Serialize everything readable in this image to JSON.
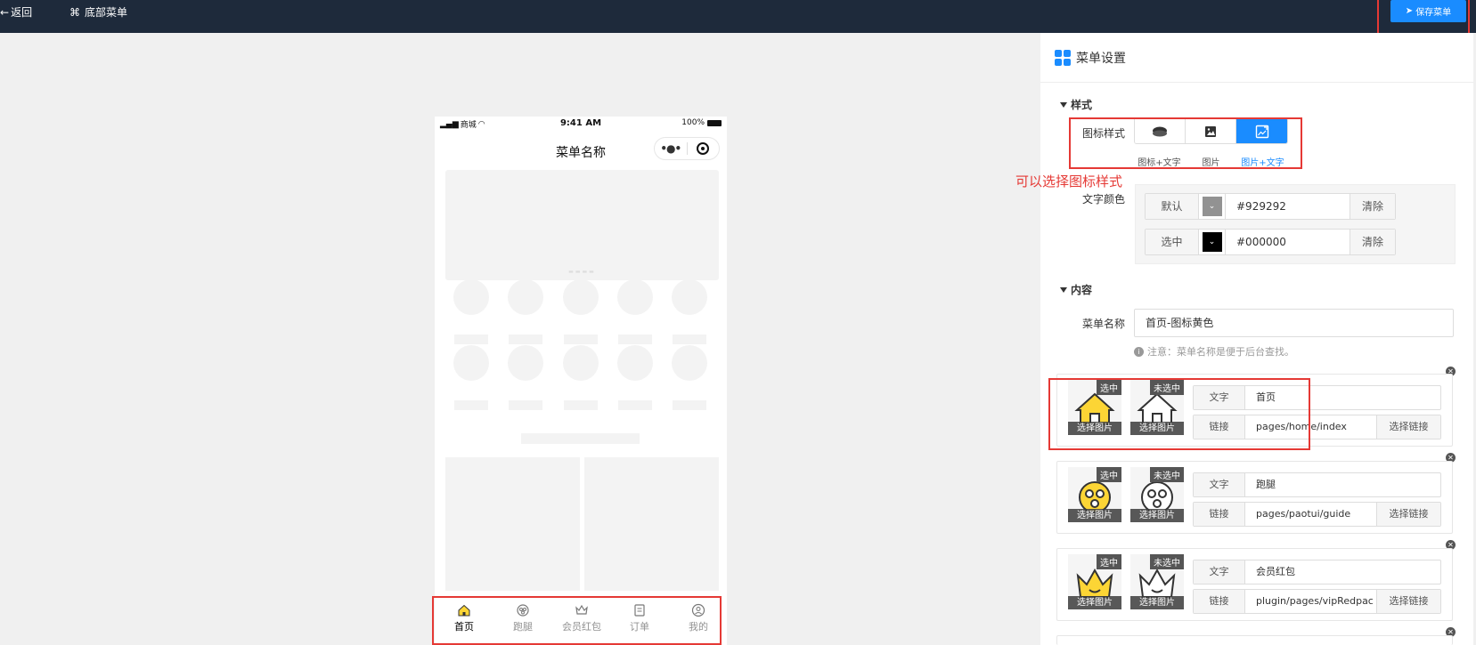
{
  "topbar": {
    "back_label": "返回",
    "title": "底部菜单",
    "save_label": "保存菜单"
  },
  "phone": {
    "carrier": "商城",
    "time": "9:41 AM",
    "battery": "100%",
    "nav_title": "菜单名称",
    "tabs": [
      {
        "label": "首页",
        "icon": "home-icon",
        "active": true
      },
      {
        "label": "跑腿",
        "icon": "scooter-icon",
        "active": false
      },
      {
        "label": "会员红包",
        "icon": "crown-icon",
        "active": false
      },
      {
        "label": "订单",
        "icon": "order-icon",
        "active": false
      },
      {
        "label": "我的",
        "icon": "user-icon",
        "active": false
      }
    ]
  },
  "panel": {
    "title": "菜单设置",
    "style_section": "样式",
    "icon_style_label": "图标样式",
    "icon_style_options": [
      {
        "caption": "图标+文字",
        "icon": "blob-icon",
        "active": false
      },
      {
        "caption": "图片",
        "icon": "image-icon",
        "active": false
      },
      {
        "caption": "图片+文字",
        "icon": "image-edit-icon",
        "active": true
      }
    ],
    "annotation": "可以选择图标样式",
    "text_color_label": "文字颜色",
    "colors": [
      {
        "label": "默认",
        "value": "#929292",
        "swatch": "#929292",
        "clear": "清除"
      },
      {
        "label": "选中",
        "value": "#000000",
        "swatch": "#000000",
        "clear": "清除"
      }
    ],
    "content_section": "内容",
    "menu_name_label": "菜单名称",
    "menu_name_value": "首页-图标黄色",
    "hint": "注意：菜单名称是便于后台查找。",
    "items": [
      {
        "selected_tag": "选中",
        "unselected_tag": "未选中",
        "choose_image": "选择图片",
        "text_label": "文字",
        "text": "首页",
        "link_label": "链接",
        "link": "pages/home/index",
        "choose_link": "选择链接",
        "icon": "home-icon"
      },
      {
        "selected_tag": "选中",
        "unselected_tag": "未选中",
        "choose_image": "选择图片",
        "text_label": "文字",
        "text": "跑腿",
        "link_label": "链接",
        "link": "pages/paotui/guide",
        "choose_link": "选择链接",
        "icon": "scooter-icon"
      },
      {
        "selected_tag": "选中",
        "unselected_tag": "未选中",
        "choose_image": "选择图片",
        "text_label": "文字",
        "text": "会员红包",
        "link_label": "链接",
        "link": "plugin/pages/vipRedpac",
        "choose_link": "选择链接",
        "icon": "crown-icon"
      }
    ]
  },
  "colors": {
    "accent": "#1a8cff",
    "topbar": "#1e2a3b",
    "highlight": "#e53935",
    "icon_yellow": "#fcd535"
  }
}
